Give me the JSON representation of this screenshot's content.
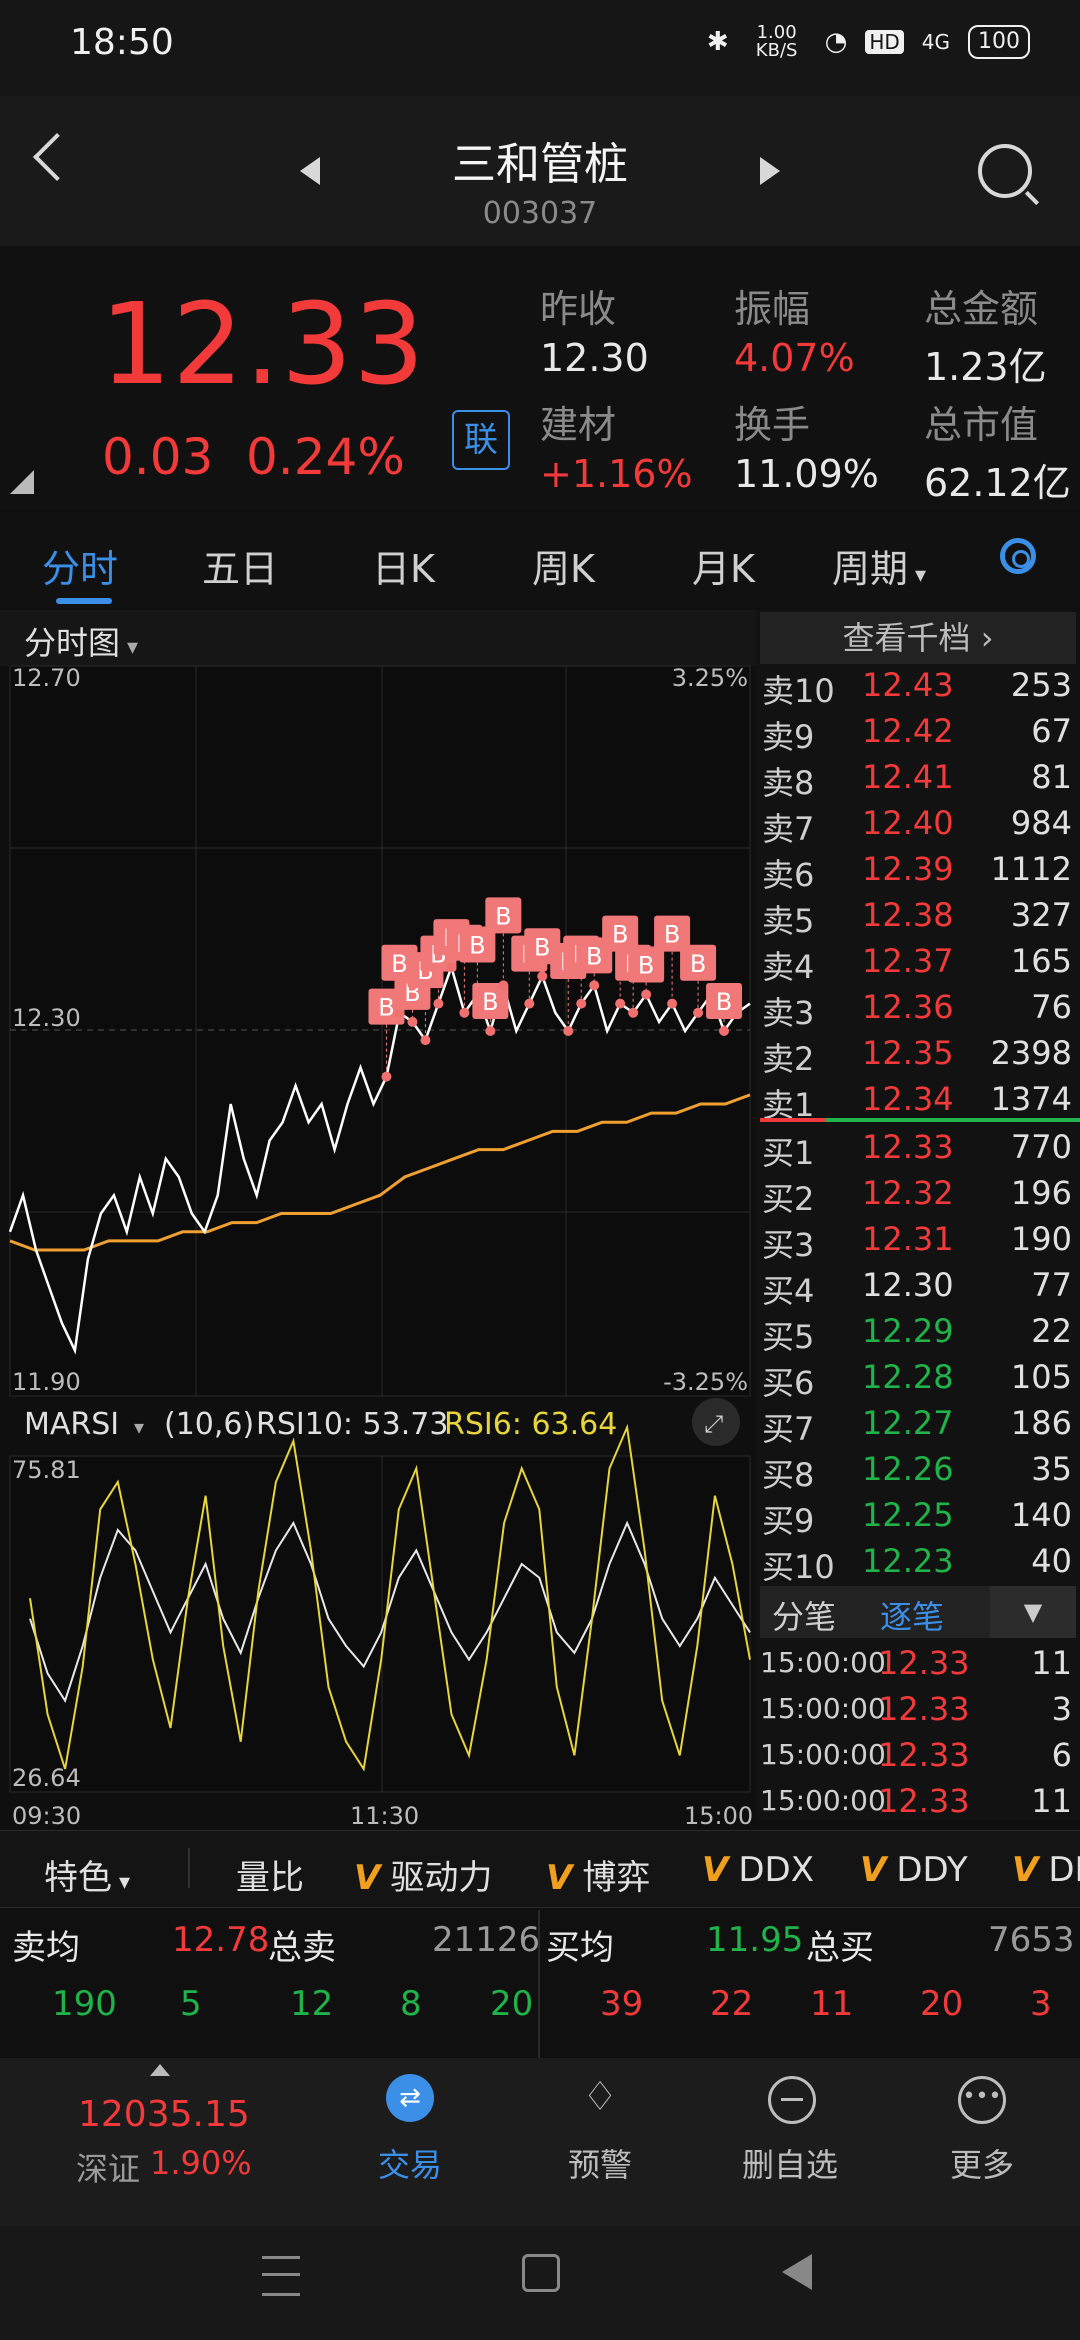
{
  "status_bar": {
    "time": "18:50",
    "net_speed": "1.00 KB/S",
    "hd": "HD",
    "signal": "4G",
    "battery": "100"
  },
  "header": {
    "stock_name": "三和管桩",
    "stock_code": "003037"
  },
  "quote": {
    "price": "12.33",
    "change": "0.03",
    "change_pct": "0.24%",
    "link_label": "联",
    "stats": [
      {
        "label": "昨收",
        "value": "12.30",
        "color": "white"
      },
      {
        "label": "振幅",
        "value": "4.07%",
        "color": "red"
      },
      {
        "label": "总金额",
        "value": "1.23亿",
        "color": "white"
      },
      {
        "label": "建材",
        "value": "+1.16%",
        "color": "red"
      },
      {
        "label": "换手",
        "value": "11.09%",
        "color": "white"
      },
      {
        "label": "总市值",
        "value": "62.12亿",
        "color": "white"
      }
    ]
  },
  "tabs": {
    "items": [
      "分时",
      "五日",
      "日K",
      "周K",
      "月K",
      "周期"
    ],
    "active": "分时"
  },
  "chart": {
    "type_label": "分时图",
    "indicator_label": "MARSI",
    "indicator_params": "(10,6)",
    "rsi10_text": "RSI10: 53.73",
    "rsi6_text": "RSI6: 63.64",
    "marker_label": "B"
  },
  "chart_data": {
    "type": "line",
    "price": {
      "ylim": [
        11.9,
        12.7
      ],
      "ytick_labels": [
        "12.70",
        "12.30",
        "11.90"
      ],
      "pct_labels": [
        "3.25%",
        "-3.25%"
      ],
      "prev_close": 12.3,
      "price_series": [
        12.08,
        12.12,
        12.06,
        12.02,
        11.98,
        11.95,
        12.05,
        12.1,
        12.12,
        12.08,
        12.14,
        12.1,
        12.16,
        12.14,
        12.1,
        12.08,
        12.12,
        12.22,
        12.16,
        12.12,
        12.18,
        12.2,
        12.24,
        12.2,
        12.22,
        12.17,
        12.22,
        12.26,
        12.22,
        12.25,
        12.32,
        12.31,
        12.29,
        12.33,
        12.37,
        12.32,
        12.34,
        12.3,
        12.35,
        12.3,
        12.33,
        12.36,
        12.32,
        12.3,
        12.33,
        12.35,
        12.3,
        12.33,
        12.32,
        12.34,
        12.31,
        12.33,
        12.3,
        12.32,
        12.34,
        12.3,
        12.32,
        12.33
      ],
      "avg_series": [
        12.07,
        12.06,
        12.06,
        12.06,
        12.07,
        12.07,
        12.07,
        12.08,
        12.08,
        12.09,
        12.09,
        12.1,
        12.1,
        12.1,
        12.11,
        12.12,
        12.14,
        12.15,
        12.16,
        12.17,
        12.17,
        12.18,
        12.19,
        12.19,
        12.2,
        12.2,
        12.21,
        12.21,
        12.22,
        12.22,
        12.23
      ],
      "x_tick_labels": [
        "09:30",
        "11:30",
        "15:00"
      ]
    },
    "rsi": {
      "ylim": [
        26.64,
        75.81
      ],
      "ytick_labels": [
        "75.81",
        "26.64"
      ],
      "series": [
        {
          "name": "RSI10",
          "values": [
            52,
            44,
            40,
            48,
            58,
            65,
            62,
            56,
            50,
            55,
            60,
            52,
            47,
            55,
            62,
            66,
            60,
            52,
            48,
            45,
            50,
            58,
            62,
            56,
            50,
            46,
            50,
            55,
            60,
            58,
            50,
            47,
            52,
            60,
            66,
            60,
            52,
            48,
            52,
            58,
            54,
            50
          ]
        },
        {
          "name": "RSI6",
          "values": [
            55,
            38,
            30,
            45,
            68,
            72,
            60,
            46,
            36,
            55,
            70,
            48,
            34,
            56,
            72,
            78,
            62,
            42,
            34,
            30,
            46,
            68,
            74,
            56,
            38,
            32,
            46,
            66,
            74,
            68,
            42,
            32,
            52,
            74,
            80,
            62,
            40,
            32,
            48,
            70,
            60,
            46
          ]
        }
      ]
    }
  },
  "order_book": {
    "view_levels_label": "查看千档",
    "asks": [
      {
        "label": "卖10",
        "price": "12.43",
        "vol": "253",
        "color": "red"
      },
      {
        "label": "卖9",
        "price": "12.42",
        "vol": "67",
        "color": "red"
      },
      {
        "label": "卖8",
        "price": "12.41",
        "vol": "81",
        "color": "red"
      },
      {
        "label": "卖7",
        "price": "12.40",
        "vol": "984",
        "color": "red"
      },
      {
        "label": "卖6",
        "price": "12.39",
        "vol": "1112",
        "color": "red"
      },
      {
        "label": "卖5",
        "price": "12.38",
        "vol": "327",
        "color": "red"
      },
      {
        "label": "卖4",
        "price": "12.37",
        "vol": "165",
        "color": "red"
      },
      {
        "label": "卖3",
        "price": "12.36",
        "vol": "76",
        "color": "red"
      },
      {
        "label": "卖2",
        "price": "12.35",
        "vol": "2398",
        "color": "red"
      },
      {
        "label": "卖1",
        "price": "12.34",
        "vol": "1374",
        "color": "red"
      }
    ],
    "bids": [
      {
        "label": "买1",
        "price": "12.33",
        "vol": "770",
        "color": "red"
      },
      {
        "label": "买2",
        "price": "12.32",
        "vol": "196",
        "color": "red"
      },
      {
        "label": "买3",
        "price": "12.31",
        "vol": "190",
        "color": "red"
      },
      {
        "label": "买4",
        "price": "12.30",
        "vol": "77",
        "color": "white"
      },
      {
        "label": "买5",
        "price": "12.29",
        "vol": "22",
        "color": "green"
      },
      {
        "label": "买6",
        "price": "12.28",
        "vol": "105",
        "color": "green"
      },
      {
        "label": "买7",
        "price": "12.27",
        "vol": "186",
        "color": "green"
      },
      {
        "label": "买8",
        "price": "12.26",
        "vol": "35",
        "color": "green"
      },
      {
        "label": "买9",
        "price": "12.25",
        "vol": "140",
        "color": "green"
      },
      {
        "label": "买10",
        "price": "12.23",
        "vol": "40",
        "color": "green"
      }
    ],
    "tick_tabs": [
      "分笔",
      "逐笔"
    ],
    "ticks": [
      {
        "time": "15:00:00",
        "price": "12.33",
        "vol": "11"
      },
      {
        "time": "15:00:00",
        "price": "12.33",
        "vol": "3"
      },
      {
        "time": "15:00:00",
        "price": "12.33",
        "vol": "6"
      },
      {
        "time": "15:00:00",
        "price": "12.33",
        "vol": "11"
      }
    ]
  },
  "feature_bar": {
    "items": [
      "特色",
      "量比",
      "驱动力",
      "博弈",
      "DDX",
      "DDY",
      "DD"
    ]
  },
  "summary": {
    "sell_avg_label": "卖均",
    "sell_avg": "12.78",
    "sell_total_label": "总卖",
    "sell_total": "21126",
    "buy_avg_label": "买均",
    "buy_avg": "11.95",
    "buy_total_label": "总买",
    "buy_total": "7653",
    "sell_row": [
      "190",
      "5",
      "12",
      "8",
      "20"
    ],
    "buy_row": [
      "39",
      "22",
      "11",
      "20",
      "3"
    ]
  },
  "bottom_nav": {
    "index_value": "12035.15",
    "index_name": "深证",
    "index_pct": "1.90%",
    "items": [
      "交易",
      "预警",
      "删自选",
      "更多"
    ]
  }
}
